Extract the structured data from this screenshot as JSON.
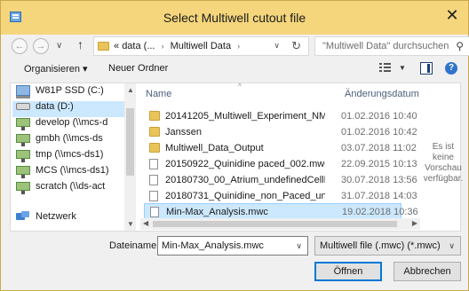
{
  "window": {
    "title": "Select Multiwell cutout file",
    "close_glyph": "✕"
  },
  "nav": {
    "back": "←",
    "forward": "→",
    "recent": "∨",
    "up": "↑",
    "address": {
      "prefix": "«",
      "crumb1": "data (...",
      "crumb2": "Multiwell Data",
      "sep": "›",
      "dropdown": "∨",
      "refresh": "↻"
    },
    "search": {
      "placeholder": "\"Multiwell Data\" durchsuchen",
      "icon": "⚲"
    }
  },
  "toolbar": {
    "organize": "Organisieren ▾",
    "new_folder": "Neuer Ordner",
    "view_dropdown": "▼",
    "help": "?"
  },
  "sidebar": {
    "items": [
      {
        "label": "W81P SSD (C:)",
        "icon": "ssd-drive-icon"
      },
      {
        "label": "data (D:)",
        "icon": "drive-icon",
        "selected": true
      },
      {
        "label": "develop (\\\\mcs-d",
        "icon": "network-drive-icon"
      },
      {
        "label": "gmbh (\\\\mcs-ds",
        "icon": "network-drive-icon"
      },
      {
        "label": "tmp (\\\\mcs-ds1)",
        "icon": "network-drive-icon"
      },
      {
        "label": "MCS (\\\\mcs-ds1)",
        "icon": "network-drive-icon"
      },
      {
        "label": "scratch (\\\\ds-act",
        "icon": "network-drive-icon"
      },
      {
        "label": "Netzwerk",
        "icon": "network-icon"
      }
    ],
    "scroll_up": "▲",
    "scroll_down": "▼"
  },
  "files": {
    "columns": {
      "name": "Name",
      "date": "Änderungsdatum",
      "sort": "^"
    },
    "rows": [
      {
        "name": "20141205_Multiwell_Experiment_NMI",
        "date": "01.02.2016 10:40",
        "type": "folder"
      },
      {
        "name": "Janssen",
        "date": "01.02.2016 10:42",
        "type": "folder"
      },
      {
        "name": "Multiwell_Data_Output",
        "date": "03.07.2018 11:02",
        "type": "folder"
      },
      {
        "name": "20150922_Quinidine paced_002.mwc",
        "date": "22.09.2015 10:13",
        "type": "file"
      },
      {
        "name": "20180730_00_Atrium_undefinedCellLine_...",
        "date": "30.07.2018 13:56",
        "type": "file"
      },
      {
        "name": "20180731_Quinidine_non_Paced_undefin...",
        "date": "31.07.2018 14:03",
        "type": "file"
      },
      {
        "name": "Min-Max_Analysis.mwc",
        "date": "19.02.2018 10:36",
        "type": "file",
        "selected": true
      }
    ],
    "scroll_left": "◀",
    "scroll_right": "▶"
  },
  "preview": {
    "text": "Es ist keine Vorschau verfügbar."
  },
  "footer": {
    "filename_label": "Dateiname:",
    "filename_value": "Min-Max_Analysis.mwc",
    "filetype_value": "Multiwell file (.mwc) (*.mwc)",
    "dropdown": "∨",
    "open_label": "Öffnen",
    "cancel_label": "Abbrechen"
  },
  "colors": {
    "titlebar": "#f5d67c",
    "selection": "#cce8ff",
    "accent": "#0078d7"
  }
}
